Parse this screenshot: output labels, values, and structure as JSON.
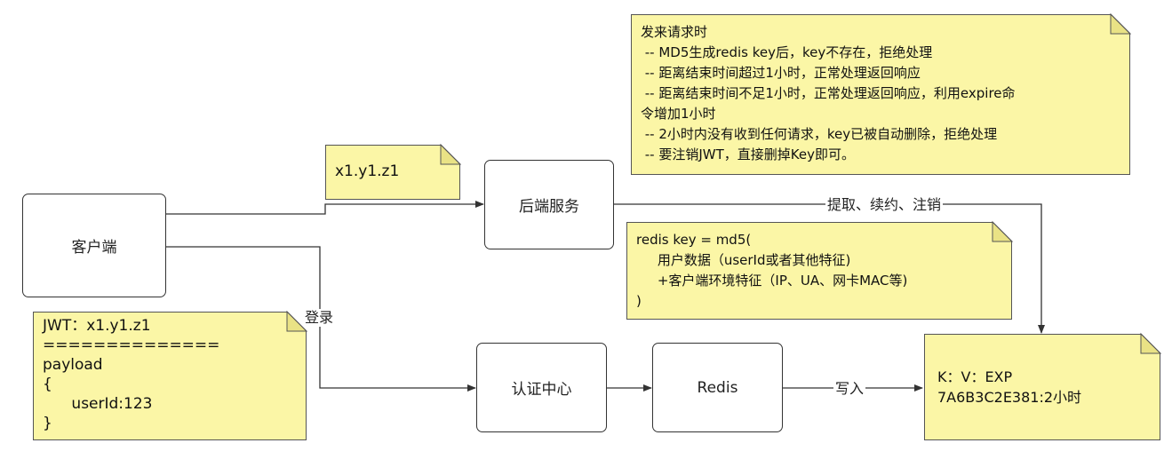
{
  "nodes": {
    "client": "客户端",
    "backend": "后端服务",
    "auth": "认证中心",
    "redis": "Redis"
  },
  "edges": {
    "login": "登录",
    "write": "写入",
    "fetch": "提取、续约、注销"
  },
  "notes": {
    "token": {
      "lines": [
        "x1.y1.z1"
      ]
    },
    "jwt": {
      "lines": [
        "JWT：x1.y1.z1",
        "==============",
        "payload",
        "{",
        "      userId:123",
        "}"
      ]
    },
    "request_rules": {
      "lines": [
        "发来请求时",
        " -- MD5生成redis key后，key不存在，拒绝处理",
        " -- 距离结束时间超过1小时，正常处理返回响应",
        " -- 距离结束时间不足1小时，正常处理返回响应，利用expire命",
        "令增加1小时",
        " -- 2小时内没有收到任何请求，key已被自动删除，拒绝处理",
        " -- 要注销JWT，直接删掉Key即可。"
      ]
    },
    "redis_key": {
      "lines": [
        "redis key = md5(",
        "     用户数据（userId或者其他特征)",
        "     +客户端环境特征（IP、UA、网卡MAC等)",
        ")"
      ]
    },
    "kv": {
      "lines": [
        "K：V：EXP",
        "7A6B3C2E381:2小时"
      ]
    }
  },
  "colors": {
    "note_fill": "#fbf6a6",
    "line": "#333333"
  }
}
